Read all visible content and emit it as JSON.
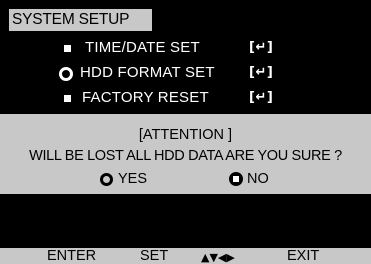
{
  "menu": {
    "title": "SYSTEM SETUP",
    "items": [
      {
        "label": "TIME/DATE SET",
        "marker": "square",
        "action": "[↵]"
      },
      {
        "label": "HDD FORMAT SET",
        "marker": "ring",
        "action": "[↵]"
      },
      {
        "label": "FACTORY RESET",
        "marker": "square",
        "action": "[↵]"
      }
    ]
  },
  "dialog": {
    "title": "[ATTENTION ]",
    "message": "WILL BE LOST ALL HDD DATA ARE YOU SURE ?",
    "options": [
      {
        "label": "YES",
        "selected": true
      },
      {
        "label": "NO",
        "selected": false
      }
    ]
  },
  "footer": {
    "enter": "ENTER",
    "set": "SET",
    "arrows": "▲▼◀▶",
    "exit": "EXIT"
  },
  "colors": {
    "background": "#000000",
    "panel": "#c8c8c8",
    "text_on_dark": "#ffffff",
    "text_on_panel": "#000000"
  }
}
